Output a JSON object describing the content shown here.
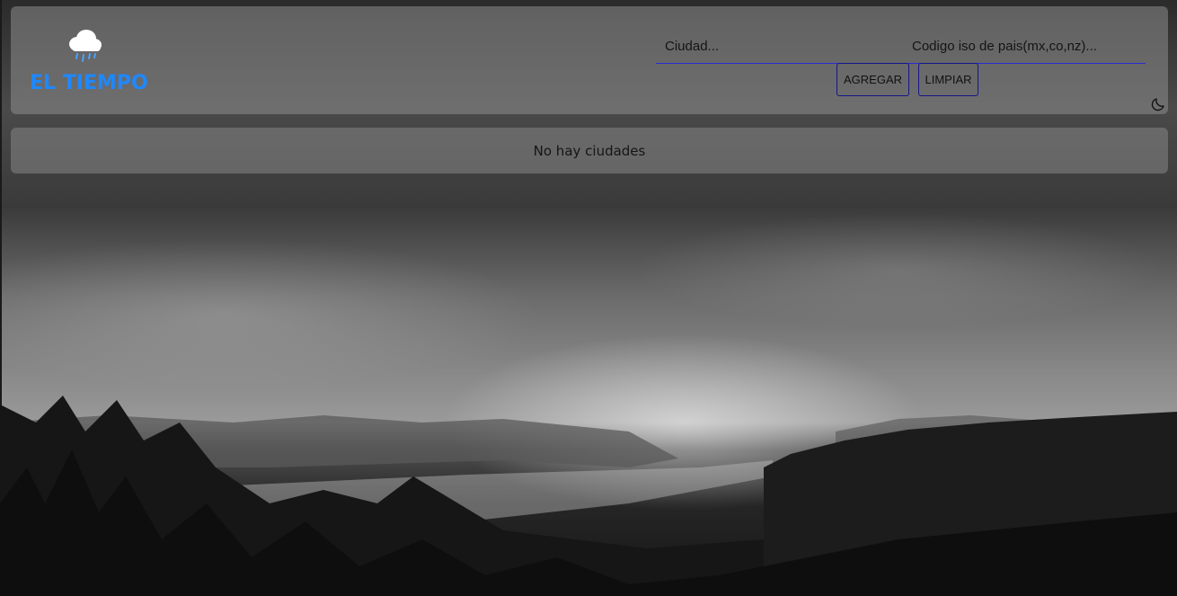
{
  "app": {
    "brand": "EL TIEMPO",
    "logo_icon": "rain-cloud-icon",
    "accent_color": "#1e88ff"
  },
  "search": {
    "city_placeholder": "Ciudad...",
    "city_value": "",
    "country_placeholder": "Codigo iso de pais(mx,co,nz)...",
    "country_value": ""
  },
  "actions": {
    "add_label": "AGREGAR",
    "clear_label": "LIMPIAR"
  },
  "theme_toggle": {
    "icon": "moon-icon"
  },
  "cities": {
    "empty_message": "No hay ciudades"
  }
}
